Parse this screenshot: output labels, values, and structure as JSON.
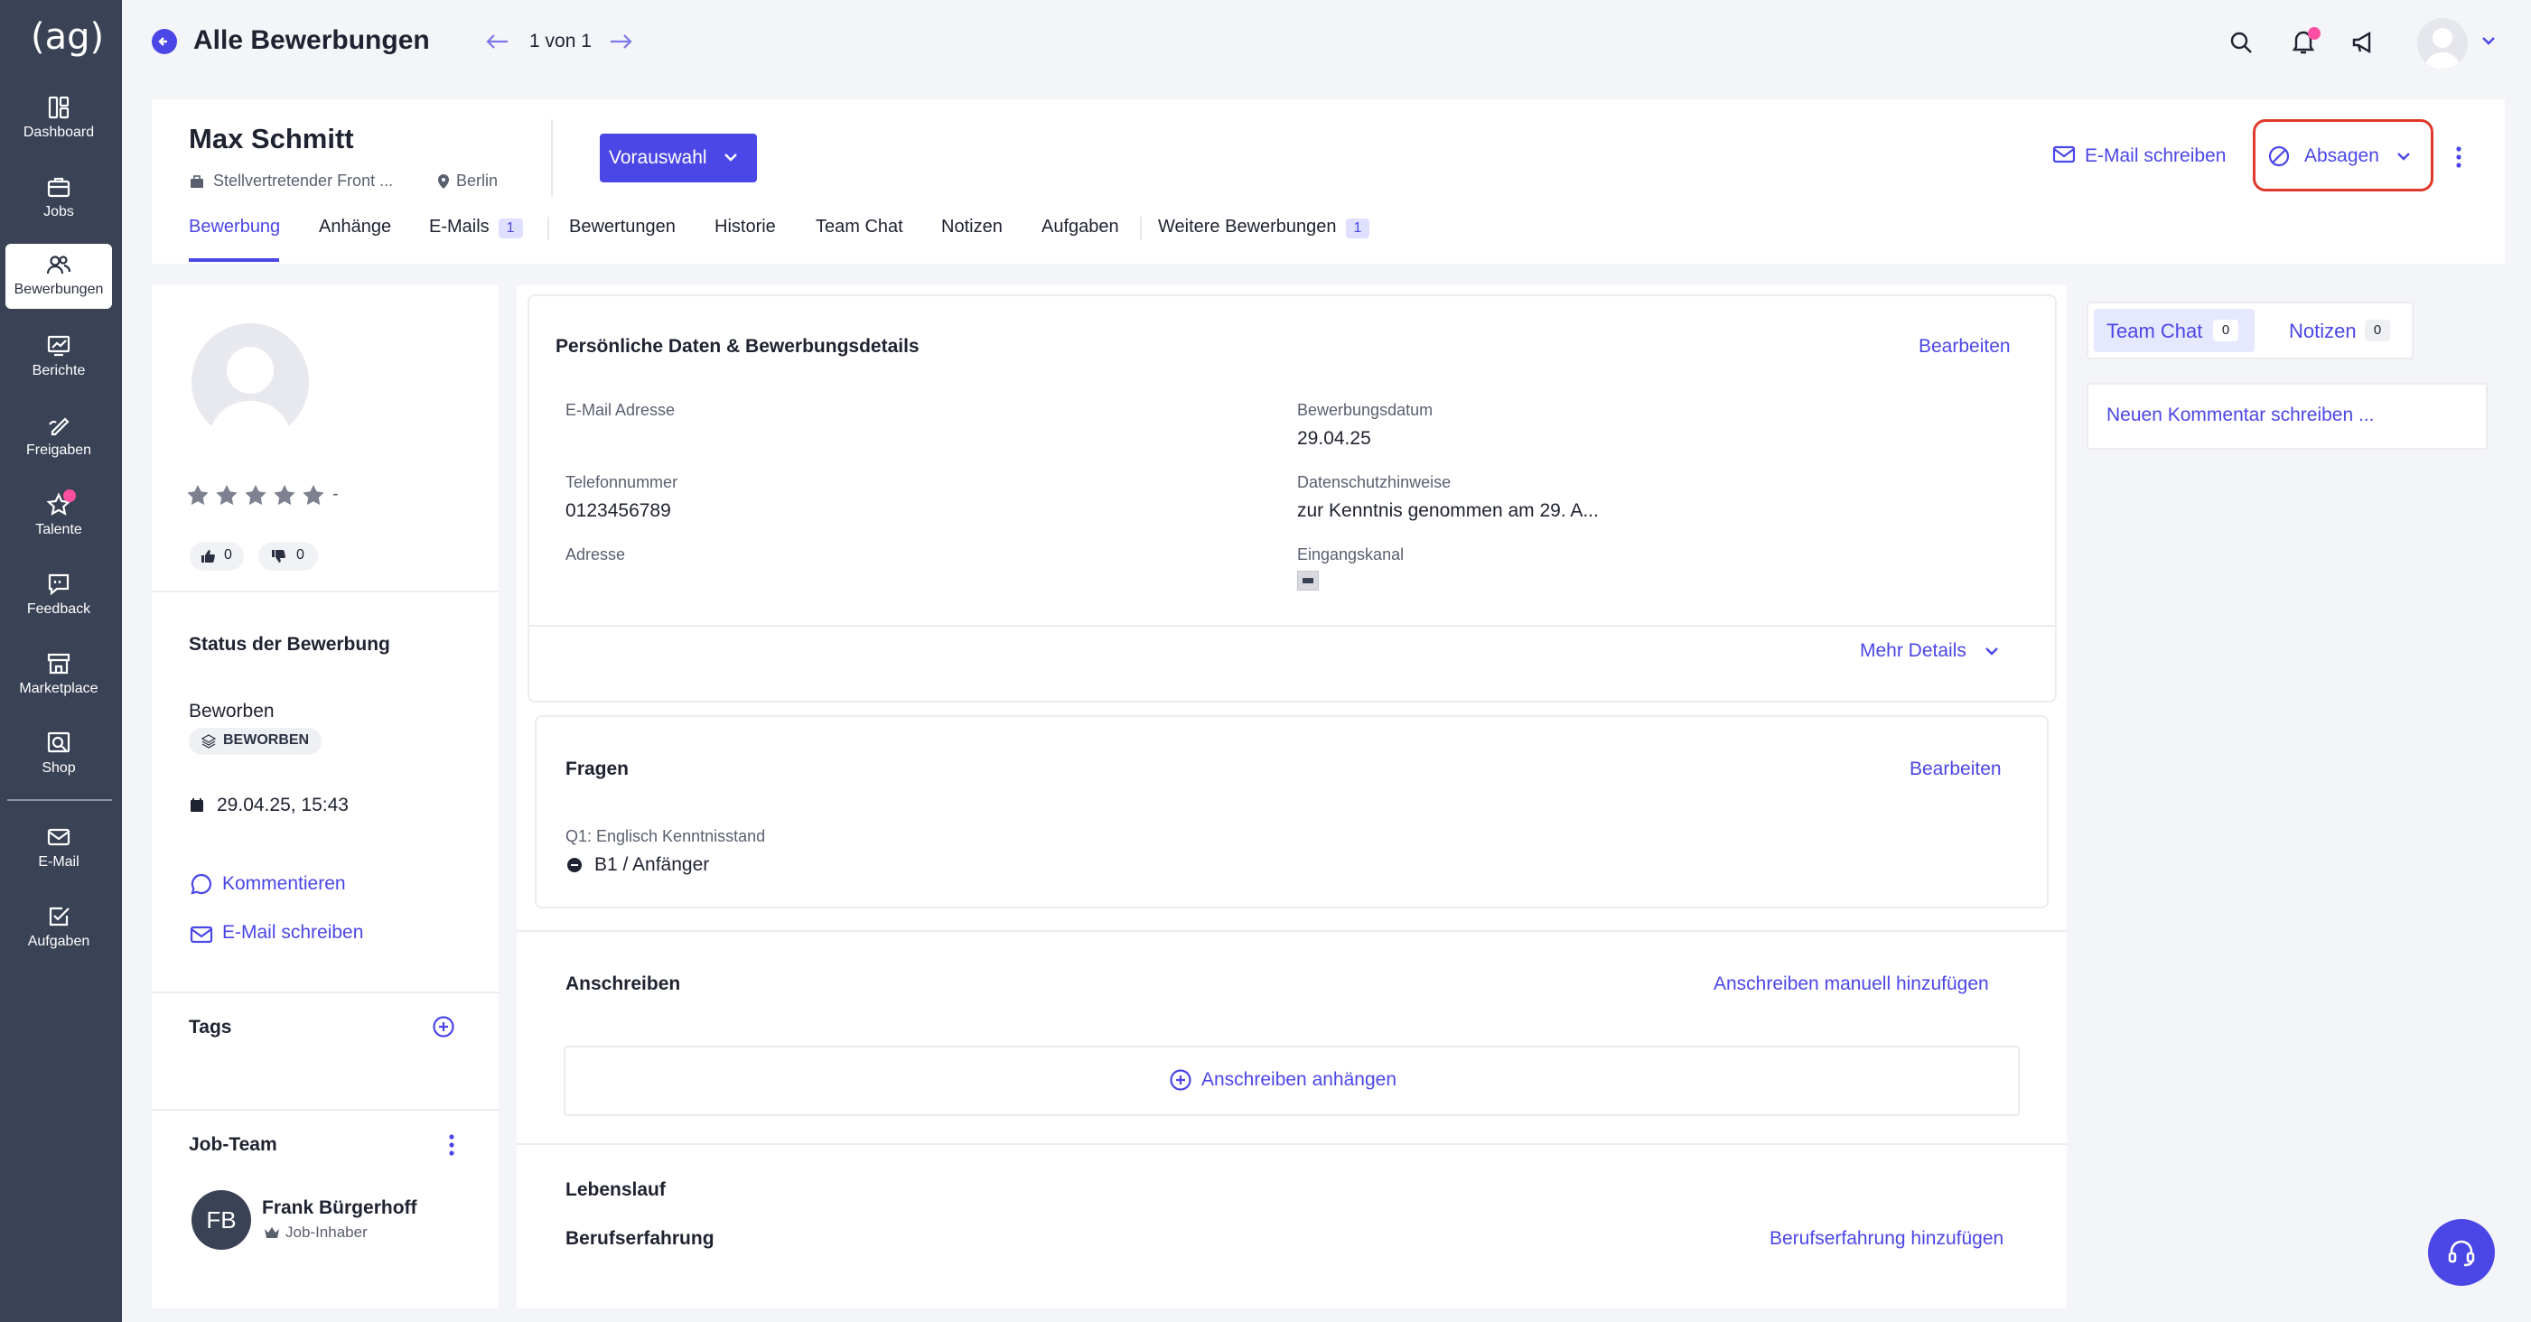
{
  "brand": {
    "logo": "(ag)"
  },
  "sidebar": {
    "items": [
      {
        "label": "Dashboard",
        "icon": "dashboard-icon"
      },
      {
        "label": "Jobs",
        "icon": "briefcase-icon"
      },
      {
        "label": "Bewerbungen",
        "icon": "users-icon",
        "active": true
      },
      {
        "label": "Berichte",
        "icon": "chart-icon"
      },
      {
        "label": "Freigaben",
        "icon": "pen-icon"
      },
      {
        "label": "Talente",
        "icon": "star-icon"
      },
      {
        "label": "Feedback",
        "icon": "feedback-icon"
      },
      {
        "label": "Marketplace",
        "icon": "store-icon"
      },
      {
        "label": "Shop",
        "icon": "shop-icon"
      },
      {
        "label": "E-Mail",
        "icon": "mail-icon"
      },
      {
        "label": "Aufgaben",
        "icon": "tasks-icon"
      }
    ]
  },
  "header": {
    "title": "Alle Bewerbungen",
    "pager": "1 von 1"
  },
  "candidate": {
    "name": "Max Schmitt",
    "job": "Stellvertretender Front ...",
    "location": "Berlin",
    "stage_button": "Vorauswahl",
    "email_action": "E-Mail schreiben",
    "reject_action": "Absagen"
  },
  "tabs": [
    {
      "label": "Bewerbung",
      "active": true
    },
    {
      "label": "Anhänge"
    },
    {
      "label": "E-Mails",
      "badge": "1"
    },
    {
      "label": "Bewertungen"
    },
    {
      "label": "Historie"
    },
    {
      "label": "Team Chat"
    },
    {
      "label": "Notizen"
    },
    {
      "label": "Aufgaben"
    },
    {
      "label": "Weitere Bewerbungen",
      "badge": "1"
    }
  ],
  "left": {
    "rating_dash": "-",
    "likes": "0",
    "dislikes": "0",
    "status_title": "Status der Bewerbung",
    "status_value": "Beworben",
    "status_badge": "BEWORBEN",
    "date": "29.04.25, 15:43",
    "comment_link": "Kommentieren",
    "email_link": "E-Mail schreiben",
    "tags_title": "Tags",
    "team_title": "Job-Team",
    "team_member": {
      "initials": "FB",
      "name": "Frank Bürgerhoff",
      "role": "Job-Inhaber"
    }
  },
  "personal": {
    "title": "Persönliche Daten & Bewerbungsdetails",
    "edit": "Bearbeiten",
    "fields": [
      {
        "label": "E-Mail Adresse",
        "value": ""
      },
      {
        "label": "Bewerbungsdatum",
        "value": "29.04.25"
      },
      {
        "label": "Telefonnummer",
        "value": "0123456789"
      },
      {
        "label": "Datenschutzhinweise",
        "value": "zur Kenntnis genommen am 29. A..."
      },
      {
        "label": "Adresse",
        "value": ""
      },
      {
        "label": "Eingangskanal",
        "value": ""
      }
    ],
    "more": "Mehr Details"
  },
  "questions": {
    "title": "Fragen",
    "edit": "Bearbeiten",
    "q1_label": "Q1: Englisch Kenntnisstand",
    "q1_value": "B1 / Anfänger"
  },
  "cover": {
    "title": "Anschreiben",
    "add_manual": "Anschreiben manuell hinzufügen",
    "attach": "Anschreiben anhängen"
  },
  "cv": {
    "title": "Lebenslauf",
    "experience": "Berufserfahrung",
    "add_experience": "Berufserfahrung hinzufügen"
  },
  "right": {
    "tab_chat": "Team Chat",
    "chat_count": "0",
    "tab_notes": "Notizen",
    "notes_count": "0",
    "comment_placeholder": "Neuen Kommentar schreiben ..."
  },
  "colors": {
    "accent": "#4b46e6",
    "sidebar": "#3a4256",
    "highlight": "#e0392b"
  }
}
